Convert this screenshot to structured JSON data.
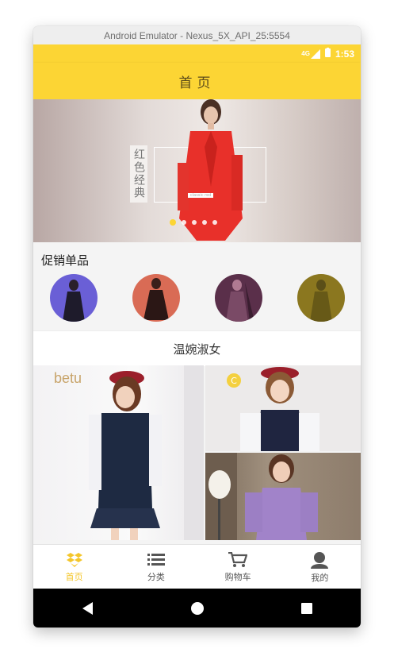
{
  "window": {
    "title": "Android Emulator - Nexus_5X_API_25:5554"
  },
  "status": {
    "network": "4G",
    "time": "1:53"
  },
  "header": {
    "title": "首页"
  },
  "banner": {
    "text": "红色经典",
    "subtext": "classic red",
    "active_slide": 1,
    "slide_count": 5
  },
  "promo": {
    "title": "促销单品"
  },
  "section": {
    "title": "温婉淑女"
  },
  "grid": {
    "brand": "betu",
    "badge": "C"
  },
  "tabs": [
    {
      "label": "首页",
      "icon": "dropbox-icon",
      "active": true
    },
    {
      "label": "分类",
      "icon": "list-icon",
      "active": false
    },
    {
      "label": "购物车",
      "icon": "cart-icon",
      "active": false
    },
    {
      "label": "我的",
      "icon": "user-icon",
      "active": false
    }
  ],
  "colors": {
    "accent": "#fcd534",
    "tab_active": "#f4c62a"
  }
}
